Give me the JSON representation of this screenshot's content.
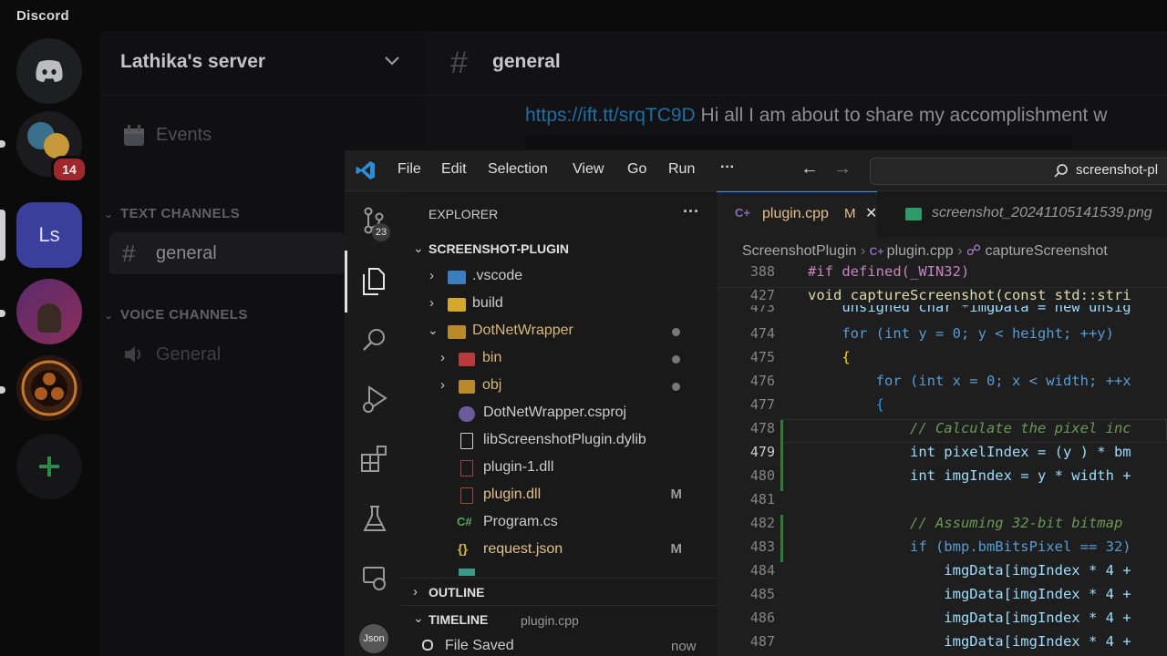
{
  "discord": {
    "app_title": "Discord",
    "badge": "14",
    "ls_label": "Ls",
    "server_name": "Lathika's server",
    "events_label": "Events",
    "text_category": "TEXT CHANNELS",
    "text_channel": "general",
    "voice_category": "VOICE CHANNELS",
    "voice_channel": "General",
    "chat_header": "general",
    "message_link": "https://ift.tt/srqTC9D",
    "message_text": " Hi all I am about to share my accomplishment w"
  },
  "vscode": {
    "menu": [
      "File",
      "Edit",
      "Selection",
      "View",
      "Go",
      "Run",
      "···"
    ],
    "search_text": "screenshot-pl",
    "source_control_badge": "23",
    "explorer_title": "EXPLORER",
    "project_title": "SCREENSHOT-PLUGIN",
    "tree": [
      {
        "label": ".vscode",
        "icon": "vscode-folder-icon",
        "marker": ""
      },
      {
        "label": "build",
        "icon": "folder-icon",
        "marker": ""
      },
      {
        "label": "DotNetWrapper",
        "icon": "folder-open-icon",
        "marker": "dot"
      },
      {
        "label": "bin",
        "icon": "bin-folder-icon",
        "marker": "dot"
      },
      {
        "label": "obj",
        "icon": "folder-icon",
        "marker": "dot"
      },
      {
        "label": "DotNetWrapper.csproj",
        "icon": "csproj-icon",
        "marker": ""
      },
      {
        "label": "libScreenshotPlugin.dylib",
        "icon": "file-icon",
        "marker": ""
      },
      {
        "label": "plugin-1.dll",
        "icon": "dll-icon",
        "marker": ""
      },
      {
        "label": "plugin.dll",
        "icon": "dll-icon",
        "marker": "M"
      },
      {
        "label": "Program.cs",
        "icon": "csharp-icon",
        "marker": ""
      },
      {
        "label": "request.json",
        "icon": "json-icon",
        "marker": "M"
      }
    ],
    "outline_label": "OUTLINE",
    "timeline_label": "TIMELINE",
    "timeline_file": "plugin.cpp",
    "timeline_entry": "File Saved",
    "timeline_time": "now",
    "tab_active": "plugin.cpp",
    "tab_active_marker": "M",
    "tab_close": "✕",
    "tab_second": "screenshot_20241105141539.png",
    "breadcrumb": [
      "ScreenshotPlugin",
      "plugin.cpp",
      "captureScreenshot"
    ],
    "code_lines": [
      {
        "n": "388",
        "t": "#if defined(_WIN32)"
      },
      {
        "n": "427",
        "t": "void captureScreenshot(const std::stri"
      },
      {
        "n": "473",
        "t": "    unsigned char *imgData = new unsig"
      },
      {
        "n": "474",
        "t": "    for (int y = 0; y < height; ++y)"
      },
      {
        "n": "475",
        "t": "    {"
      },
      {
        "n": "476",
        "t": "        for (int x = 0; x < width; ++x"
      },
      {
        "n": "477",
        "t": "        {"
      },
      {
        "n": "478",
        "t": "            // Calculate the pixel inc"
      },
      {
        "n": "479",
        "t": "            int pixelIndex = (y ) * bm"
      },
      {
        "n": "480",
        "t": "            int imgIndex = y * width +"
      },
      {
        "n": "481",
        "t": ""
      },
      {
        "n": "482",
        "t": "            // Assuming 32-bit bitmap"
      },
      {
        "n": "483",
        "t": "            if (bmp.bmBitsPixel == 32)"
      },
      {
        "n": "484",
        "t": "                imgData[imgIndex * 4 +"
      },
      {
        "n": "485",
        "t": "                imgData[imgIndex * 4 +"
      },
      {
        "n": "486",
        "t": "                imgData[imgIndex * 4 +"
      },
      {
        "n": "487",
        "t": "                imgData[imgIndex * 4 +"
      }
    ]
  }
}
